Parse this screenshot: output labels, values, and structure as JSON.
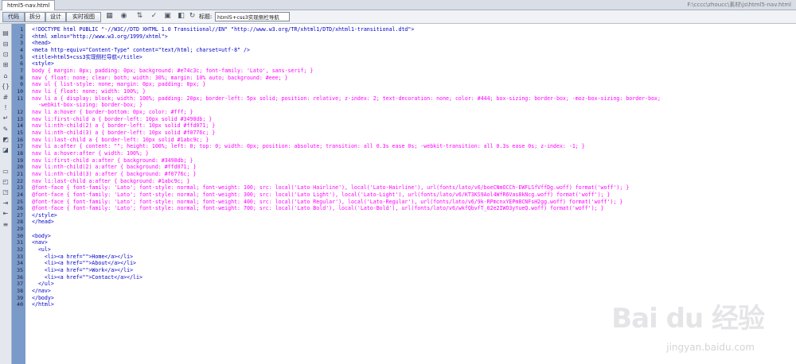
{
  "document_tab": "html5-nav.html",
  "file_path": "F:\\cccc\\zhoucc\\素材\\js\\html5-nav.html",
  "view_buttons": [
    {
      "label": "代码",
      "active": true
    },
    {
      "label": "拆分",
      "active": false
    },
    {
      "label": "设计",
      "active": false
    },
    {
      "label": "实时视图",
      "active": false
    }
  ],
  "toolbar_icons": [
    "multiscreen-icon",
    "preview-icon",
    "file-manage-icon",
    "validate-icon",
    "check-browser-icon",
    "visual-aids-icon",
    "refresh-icon"
  ],
  "title_field": {
    "label": "标题:",
    "value": "html5+css3实现侧栏导航"
  },
  "sidebar_icons": [
    "open-documents-icon",
    "collapse-tag-icon",
    "collapse-selection-icon",
    "expand-all-icon",
    "select-parent-icon",
    "balance-braces-icon",
    "line-numbers-icon",
    "highlight-invalid-icon",
    "word-wrap-icon",
    "syntax-color-icon",
    "apply-comment-icon",
    "remove-comment-icon",
    "wrap-tag-icon",
    "recent-snippets-icon",
    "move-css-icon",
    "indent-icon",
    "outdent-icon",
    "format-source-icon"
  ],
  "code_lines": [
    {
      "text": "<!DOCTYPE html PUBLIC \"-//W3C//DTD XHTML 1.0 Transitional//EN\" \"http://www.w3.org/TR/xhtml1/DTD/xhtml1-transitional.dtd\">",
      "kind": "markup"
    },
    {
      "text": "<html xmlns=\"http://www.w3.org/1999/xhtml\">",
      "kind": "markup"
    },
    {
      "text": "<head>",
      "kind": "markup"
    },
    {
      "text": "<meta http-equiv=\"Content-Type\" content=\"text/html; charset=utf-8\" />",
      "kind": "markup"
    },
    {
      "text": "<title>html5+css3实现侧栏导航</title>",
      "kind": "markup"
    },
    {
      "text": "<style>",
      "kind": "markup"
    },
    {
      "text": "body { margin: 0px; padding: 0px; background: #e74c3c; font-family: 'Lato', sans-serif; }",
      "kind": "css"
    },
    {
      "text": "nav { float: none; clear: both; width: 30%; margin: 10% auto; background: #eee; }",
      "kind": "css"
    },
    {
      "text": "nav ul { list-style: none; margin: 0px; padding: 0px; }",
      "kind": "css"
    },
    {
      "text": "nav li { float: none; width: 100%; }",
      "kind": "css"
    },
    {
      "text": "nav li a { display: block; width: 100%; padding: 20px; border-left: 5px solid; position: relative; z-index: 2; text-decoration: none; color: #444; box-sizing: border-box; -moz-box-sizing: border-box;",
      "kind": "css"
    },
    {
      "text": "  -webkit-box-sizing: border-box; }",
      "kind": "css"
    },
    {
      "text": "nav li a:hover { border-bottom: 0px; color: #fff; }",
      "kind": "css"
    },
    {
      "text": "nav li:first-child a { border-left: 10px solid #3498db; }",
      "kind": "css"
    },
    {
      "text": "nav li:nth-child(2) a { border-left: 10px solid #ffd071; }",
      "kind": "css"
    },
    {
      "text": "nav li:nth-child(3) a { border-left: 10px solid #f0776c; }",
      "kind": "css"
    },
    {
      "text": "nav li:last-child a { border-left: 10px solid #1abc9c; }",
      "kind": "css"
    },
    {
      "text": "nav li a:after { content: \"\"; height: 100%; left: 0; top: 0; width: 0px; position: absolute; transition: all 0.3s ease 0s; -webkit-transition: all 0.3s ease 0s; z-index: -1; }",
      "kind": "css"
    },
    {
      "text": "nav li a:hover:after { width: 100%; }",
      "kind": "css"
    },
    {
      "text": "nav li:first-child a:after { background: #3498db; }",
      "kind": "css"
    },
    {
      "text": "nav li:nth-child(2) a:after { background: #ffd071; }",
      "kind": "css"
    },
    {
      "text": "nav li:nth-child(3) a:after { background: #f0776c; }",
      "kind": "css"
    },
    {
      "text": "nav li:last-child a:after { background: #1abc9c; }",
      "kind": "css"
    },
    {
      "text": "@font-face { font-family: 'Lato'; font-style: normal; font-weight: 100; src: local('Lato Hairline'), local('Lato-Hairline'), url(fonts/lato/v6/boeCNmOCCh-EWFLSfVffDg.woff) format('woff'); }",
      "kind": "fontface"
    },
    {
      "text": "@font-face { font-family: 'Lato'; font-style: normal; font-weight: 300; src: local('Lato Light'), local('Lato-Light'), url(fonts/lato/v6/KT3KS9Aol4WfR6Vas8kNcg.woff) format('woff'); }",
      "kind": "fontface"
    },
    {
      "text": "@font-face { font-family: 'Lato'; font-style: normal; font-weight: 400; src: local('Lato Regular'), local('Lato-Regular'), url(fonts/lato/v6/9k-RPmcnxYEPm8CNFsH2gg.woff) format('woff'); }",
      "kind": "fontface"
    },
    {
      "text": "@font-face { font-family: 'Lato'; font-style: normal; font-weight: 700; src: local('Lato Bold'), local('Lato-Bold'), url(fonts/lato/v6/wkfQbvfT_02e2IWO3yYueQ.woff) format('woff'); }",
      "kind": "fontface"
    },
    {
      "text": "</style>",
      "kind": "markup"
    },
    {
      "text": "</head>",
      "kind": "markup"
    },
    {
      "text": "",
      "kind": "markup"
    },
    {
      "text": "<body>",
      "kind": "markup"
    },
    {
      "text": "<nav>",
      "kind": "markup"
    },
    {
      "text": "  <ul>",
      "kind": "markup"
    },
    {
      "text": "    <li><a href=\"\">Home</a></li>",
      "kind": "markup"
    },
    {
      "text": "    <li><a href=\"\">About</a></li>",
      "kind": "markup"
    },
    {
      "text": "    <li><a href=\"\">Work</a></li>",
      "kind": "markup"
    },
    {
      "text": "    <li><a href=\"\">Contact</a></li>",
      "kind": "markup"
    },
    {
      "text": "  </ul>",
      "kind": "markup"
    },
    {
      "text": "</nav>",
      "kind": "markup"
    },
    {
      "text": "</body>",
      "kind": "markup"
    },
    {
      "text": "</html>",
      "kind": "markup"
    }
  ],
  "line_numbers": [
    "1",
    "2",
    "3",
    "4",
    "5",
    "6",
    "7",
    "8",
    "9",
    "10",
    "11",
    "",
    "12",
    "13",
    "14",
    "15",
    "16",
    "17",
    "18",
    "19",
    "20",
    "21",
    "22",
    "23",
    "24",
    "25",
    "26",
    "27",
    "28",
    "29",
    "30",
    "31",
    "32",
    "33",
    "34",
    "35",
    "36",
    "37",
    "38",
    "39",
    "40",
    "41"
  ],
  "watermark": {
    "logo": "Bai du 经验",
    "url": "jingyan.baidu.com"
  }
}
